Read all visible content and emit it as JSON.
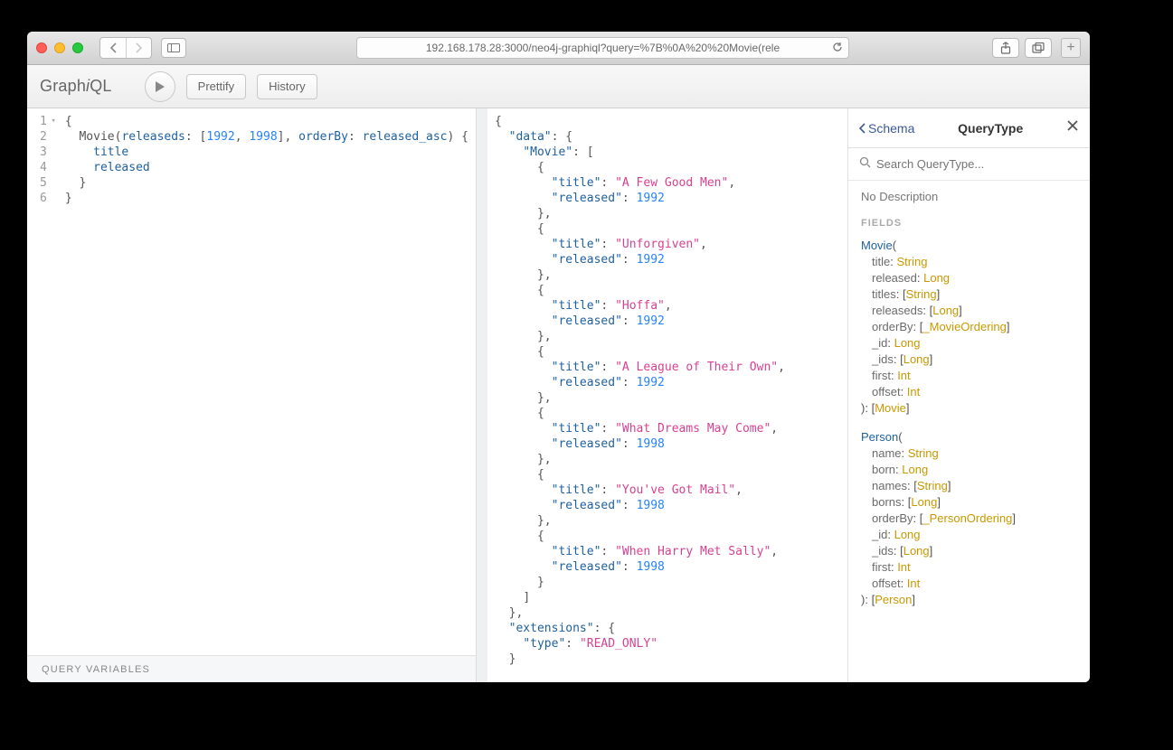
{
  "browser": {
    "url": "192.168.178.28:3000/neo4j-graphiql?query=%7B%0A%20%20Movie(rele"
  },
  "toolbar": {
    "logo_pre": "Graph",
    "logo_i": "i",
    "logo_post": "QL",
    "prettify": "Prettify",
    "history": "History"
  },
  "editor": {
    "lines": [
      "1",
      "2",
      "3",
      "4",
      "5",
      "6"
    ],
    "query_variables_label": "QUERY VARIABLES",
    "l1": "{",
    "l2_a": "  Movie(",
    "l2_b": "releaseds",
    "l2_c": ": [",
    "l2_d": "1992",
    "l2_e": ", ",
    "l2_f": "1998",
    "l2_g": "], ",
    "l2_h": "orderBy",
    "l2_i": ": ",
    "l2_j": "released_asc",
    "l2_k": ") {",
    "l3": "    title",
    "l4": "    released",
    "l5": "  }",
    "l6": "}"
  },
  "result": {
    "data": {
      "Movie": [
        {
          "title": "A Few Good Men",
          "released": 1992
        },
        {
          "title": "Unforgiven",
          "released": 1992
        },
        {
          "title": "Hoffa",
          "released": 1992
        },
        {
          "title": "A League of Their Own",
          "released": 1992
        },
        {
          "title": "What Dreams May Come",
          "released": 1998
        },
        {
          "title": "You've Got Mail",
          "released": 1998
        },
        {
          "title": "When Harry Met Sally",
          "released": 1998
        }
      ]
    },
    "extensions_type": "READ_ONLY"
  },
  "docs": {
    "back_label": "Schema",
    "title": "QueryType",
    "search_placeholder": "Search QueryType...",
    "no_description": "No Description",
    "fields_label": "FIELDS",
    "movie": {
      "name": "Movie",
      "args": [
        {
          "n": "title",
          "t": "String"
        },
        {
          "n": "released",
          "t": "Long"
        },
        {
          "n": "titles",
          "t": "[String]"
        },
        {
          "n": "releaseds",
          "t": "[Long]"
        },
        {
          "n": "orderBy",
          "t": "[_MovieOrdering]"
        },
        {
          "n": "_id",
          "t": "Long"
        },
        {
          "n": "_ids",
          "t": "[Long]"
        },
        {
          "n": "first",
          "t": "Int"
        },
        {
          "n": "offset",
          "t": "Int"
        }
      ],
      "ret": "[Movie]"
    },
    "person": {
      "name": "Person",
      "args": [
        {
          "n": "name",
          "t": "String"
        },
        {
          "n": "born",
          "t": "Long"
        },
        {
          "n": "names",
          "t": "[String]"
        },
        {
          "n": "borns",
          "t": "[Long]"
        },
        {
          "n": "orderBy",
          "t": "[_PersonOrdering]"
        },
        {
          "n": "_id",
          "t": "Long"
        },
        {
          "n": "_ids",
          "t": "[Long]"
        },
        {
          "n": "first",
          "t": "Int"
        },
        {
          "n": "offset",
          "t": "Int"
        }
      ],
      "ret": "[Person]"
    }
  }
}
